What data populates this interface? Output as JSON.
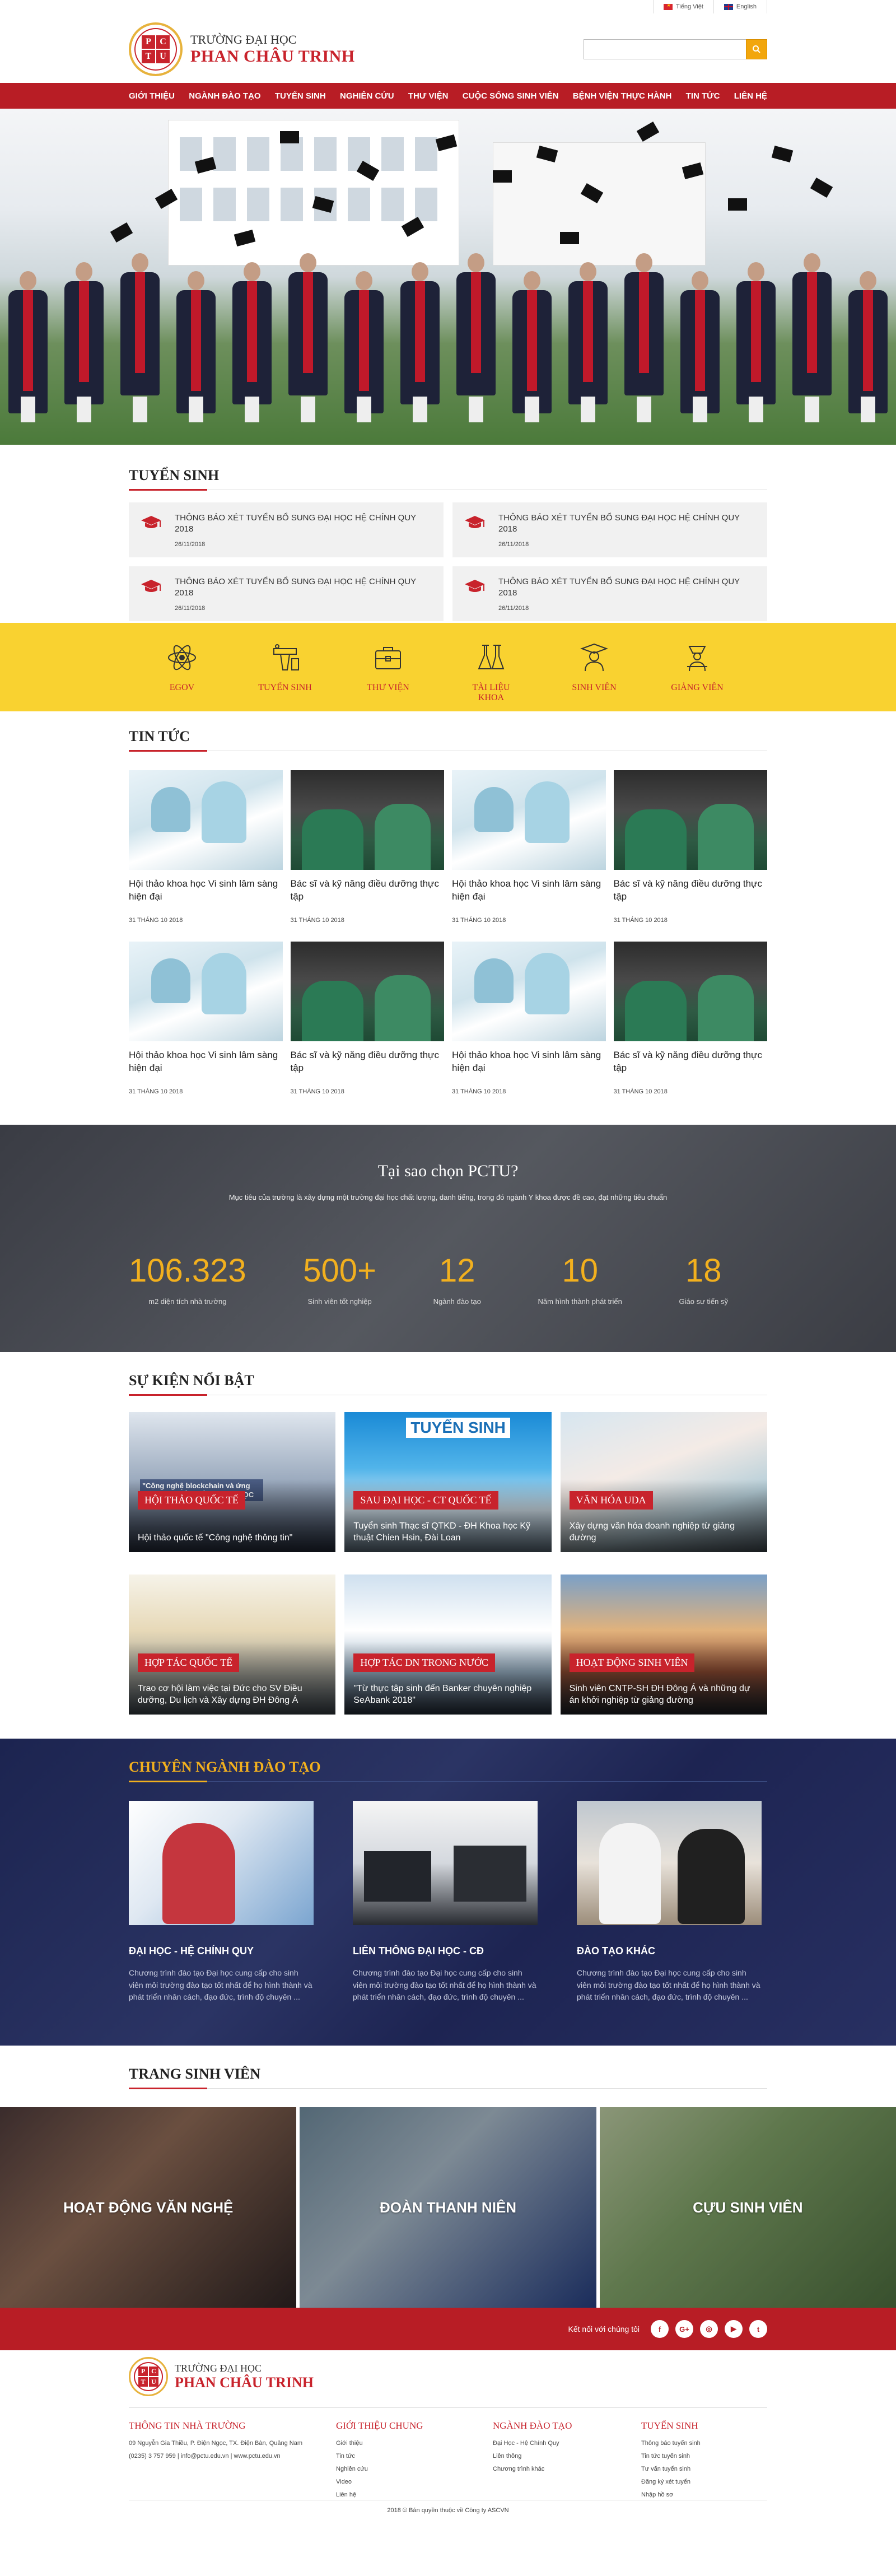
{
  "lang": [
    {
      "label": "Tiếng Việt"
    },
    {
      "label": "English"
    }
  ],
  "brand": {
    "line1": "TRƯỜNG ĐẠI HỌC",
    "line2": "PHAN CHÂU TRINH",
    "seal": [
      "P",
      "C",
      "T",
      "U"
    ]
  },
  "search": {
    "placeholder": "",
    "icon": "search-icon"
  },
  "nav": [
    "GIỚI THIỆU",
    "NGÀNH ĐÀO TẠO",
    "TUYỂN SINH",
    "NGHIÊN CỨU",
    "THƯ VIỆN",
    "CUỘC SỐNG SINH VIÊN",
    "BỆNH VIỆN THỰC HÀNH",
    "TIN TỨC",
    "LIÊN HỆ"
  ],
  "admissions": {
    "title": "TUYỂN SINH",
    "items": [
      {
        "title": "THÔNG BÁO XÉT TUYỂN BỔ SUNG ĐẠI HỌC HỆ CHÍNH QUY 2018",
        "date": "26/11/2018"
      },
      {
        "title": "THÔNG BÁO XÉT TUYỂN BỔ SUNG ĐẠI HỌC HỆ CHÍNH QUY 2018",
        "date": "26/11/2018"
      },
      {
        "title": "THÔNG BÁO XÉT TUYỂN BỔ SUNG ĐẠI HỌC HỆ CHÍNH QUY 2018",
        "date": "26/11/2018"
      },
      {
        "title": "THÔNG BÁO XÉT TUYỂN BỔ SUNG ĐẠI HỌC HỆ CHÍNH QUY 2018",
        "date": "26/11/2018"
      }
    ]
  },
  "quicklinks": [
    {
      "label": "EGOV",
      "icon": "atom-icon"
    },
    {
      "label": "TUYỂN SINH",
      "icon": "lectern-icon"
    },
    {
      "label": "THƯ VIỆN",
      "icon": "briefcase-icon"
    },
    {
      "label": "TÀI LIỆU KHOA",
      "icon": "flask-icon"
    },
    {
      "label": "SINH VIÊN",
      "icon": "graduate-icon"
    },
    {
      "label": "GIẢNG VIÊN",
      "icon": "teacher-icon"
    }
  ],
  "news": {
    "title": "TIN TỨC",
    "items": [
      {
        "title": "Hội thảo khoa học Vi sinh lâm sàng hiện đại",
        "date": "31 THÁNG 10 2018",
        "img": "lab"
      },
      {
        "title": "Bác sĩ và kỹ năng điều dưỡng thực tập",
        "date": "31 THÁNG 10 2018",
        "img": "nurse"
      },
      {
        "title": "Hội thảo khoa học Vi sinh lâm sàng hiện đại",
        "date": "31 THÁNG 10 2018",
        "img": "lab"
      },
      {
        "title": "Bác sĩ và kỹ năng điều dưỡng thực tập",
        "date": "31 THÁNG 10 2018",
        "img": "nurse"
      },
      {
        "title": "Hội thảo khoa học Vi sinh lâm sàng hiện đại",
        "date": "31 THÁNG 10 2018",
        "img": "lab"
      },
      {
        "title": "Bác sĩ và kỹ năng điều dưỡng thực tập",
        "date": "31 THÁNG 10 2018",
        "img": "nurse"
      },
      {
        "title": "Hội thảo khoa học Vi sinh lâm sàng hiện đại",
        "date": "31 THÁNG 10 2018",
        "img": "lab"
      },
      {
        "title": "Bác sĩ và kỹ năng điều dưỡng thực tập",
        "date": "31 THÁNG 10 2018",
        "img": "nurse"
      }
    ]
  },
  "why": {
    "title": "Tại sao chọn PCTU?",
    "subtitle": "Mục tiêu của trường là xây dựng một trường đại học chất lượng, danh tiếng, trong đó ngành Y khoa được đề cao, đạt những tiêu chuẩn",
    "stats": [
      {
        "num": "106.323",
        "label": "m2 diện tích nhà trường"
      },
      {
        "num": "500+",
        "label": "Sinh viên tốt nghiệp"
      },
      {
        "num": "12",
        "label": "Ngành đào tạo"
      },
      {
        "num": "10",
        "label": "Năm hình thành phát triển"
      },
      {
        "num": "18",
        "label": "Giáo sư tiến sỹ"
      }
    ]
  },
  "events": {
    "title": "SỰ KIỆN NỔI BẬT",
    "items": [
      {
        "tag": "Hội thảo quốc tế",
        "caption": "Hội thảo quốc tế \"Công nghệ thông tin\"",
        "bg": "a",
        "overlay": "\"Công nghệ blockchain và ứng dụng\" NGHIÊN CỨU KHOA HỌC"
      },
      {
        "tag": "SAU ĐẠI HỌC - CT QUỐC TẾ",
        "caption": "Tuyển sinh Thạc sĩ QTKD - ĐH Khoa học Kỹ thuật Chien Hsin, Đài Loan",
        "bg": "b",
        "overlay": "TUYỂN SINH"
      },
      {
        "tag": "VĂN HÓA UDA",
        "caption": "Xây dựng văn hóa doanh nghiệp từ giảng đường",
        "bg": "c",
        "overlay": ""
      },
      {
        "tag": "HỢP TÁC QUỐC TẾ",
        "caption": "Trao cơ hội làm việc tại Đức cho SV Điều dưỡng, Du lịch và Xây dựng ĐH Đông Á",
        "bg": "d",
        "overlay": ""
      },
      {
        "tag": "HỢP TÁC DN TRONG NƯỚC",
        "caption": "\"Từ thực tập sinh đến Banker chuyên nghiệp SeAbank 2018\"",
        "bg": "e",
        "overlay": ""
      },
      {
        "tag": "HOẠT ĐỘNG SINH VIÊN",
        "caption": "Sinh viên CNTP-SH ĐH Đông Á và những dự án khởi nghiệp từ giảng đường",
        "bg": "f",
        "overlay": ""
      }
    ]
  },
  "programs": {
    "title": "CHUYÊN NGÀNH ĐÀO TẠO",
    "items": [
      {
        "title": "ĐẠI HỌC - HỆ CHÍNH QUY",
        "desc": "Chương trình đào tạo Đại học cung cấp cho sinh viên môi trường đào tạo tốt nhất để họ hình thành và phát triển nhân cách, đạo đức, trình độ chuyên ...",
        "img": "a"
      },
      {
        "title": "LIÊN THÔNG ĐẠI HỌC - CĐ",
        "desc": "Chương trình đào tạo Đại học cung cấp cho sinh viên môi trường đào tạo tốt nhất để họ hình thành và phát triển nhân cách, đạo đức, trình độ chuyên ...",
        "img": "b"
      },
      {
        "title": "ĐÀO TẠO KHÁC",
        "desc": "Chương trình đào tạo Đại học cung cấp cho sinh viên môi trường đào tạo tốt nhất để họ hình thành và phát triển nhân cách, đạo đức, trình độ chuyên ...",
        "img": "c"
      }
    ]
  },
  "student": {
    "title": "TRANG SINH VIÊN",
    "items": [
      {
        "label": "HOẠT ĐỘNG VĂN NGHỆ",
        "bg": "a"
      },
      {
        "label": "ĐOÀN THANH NIÊN",
        "bg": "b"
      },
      {
        "label": "CỰU SINH VIÊN",
        "bg": "c"
      }
    ]
  },
  "social": {
    "label": "Kết nối với chúng tôi",
    "icons": [
      {
        "t": "f",
        "name": "facebook-icon"
      },
      {
        "t": "G+",
        "name": "google-plus-icon"
      },
      {
        "t": "◎",
        "name": "instagram-icon"
      },
      {
        "t": "▶",
        "name": "youtube-icon"
      },
      {
        "t": "t",
        "name": "twitter-icon"
      }
    ]
  },
  "footer": {
    "cols": [
      {
        "title": "THÔNG TIN NHÀ TRƯỜNG",
        "items": [
          "09 Nguyễn Gia Thiều, P. Điện Ngọc, TX. Điện Bàn, Quảng Nam",
          "(0235) 3 757 959 | info@pctu.edu.vn | www.pctu.edu.vn"
        ]
      },
      {
        "title": "GIỚI THIỆU CHUNG",
        "items": [
          "Giới thiệu",
          "Tin tức",
          "Nghiên cứu",
          "Video",
          "Liên hệ"
        ]
      },
      {
        "title": "NGÀNH ĐÀO TẠO",
        "items": [
          "Đại Học - Hệ Chính Quy",
          "Liên thông",
          "Chương trình khác"
        ]
      },
      {
        "title": "TUYỂN SINH",
        "items": [
          "Thông báo tuyển sinh",
          "Tin tức tuyển sinh",
          "Tư vấn tuyển sinh",
          "Đăng ký xét tuyển",
          "Nhập hồ sơ"
        ]
      }
    ],
    "copyright": "2018 © Bản quyền thuộc về Công ty ASCVN"
  }
}
